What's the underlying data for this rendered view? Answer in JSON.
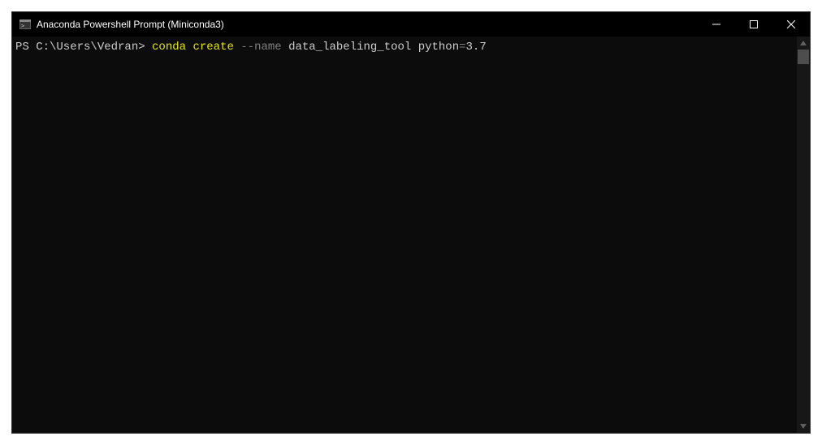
{
  "titlebar": {
    "title": "Anaconda Powershell Prompt (Miniconda3)"
  },
  "terminal": {
    "prompt": "PS C:\\Users\\Vedran> ",
    "cmd_part1": "conda ",
    "cmd_part2": "create ",
    "cmd_part3": "--name ",
    "cmd_part4": "data_labeling_tool python",
    "cmd_part5": "=",
    "cmd_part6": "3.7"
  },
  "icons": {
    "minimize": "minimize-icon",
    "maximize": "maximize-icon",
    "close": "close-icon",
    "app": "terminal-app-icon",
    "scroll_up": "scroll-up-icon",
    "scroll_down": "scroll-down-icon"
  }
}
